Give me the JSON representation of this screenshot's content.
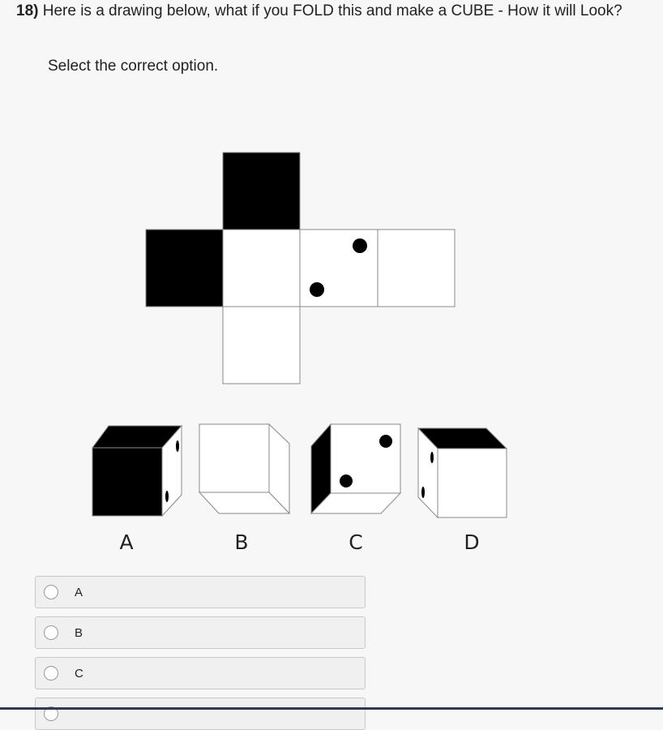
{
  "question": {
    "number": "18)",
    "text": "Here is a drawing below, what if you FOLD this and make a CUBE - How it will Look?"
  },
  "instruction": "Select the correct option.",
  "figure": {
    "option_labels": [
      "A",
      "B",
      "C",
      "D"
    ]
  },
  "choices": [
    {
      "label": "A"
    },
    {
      "label": "B"
    },
    {
      "label": "C"
    },
    {
      "label": ""
    }
  ],
  "colors": {
    "background": "#f7f7f7",
    "face_dark": "#000000",
    "face_light": "#ffffff"
  }
}
